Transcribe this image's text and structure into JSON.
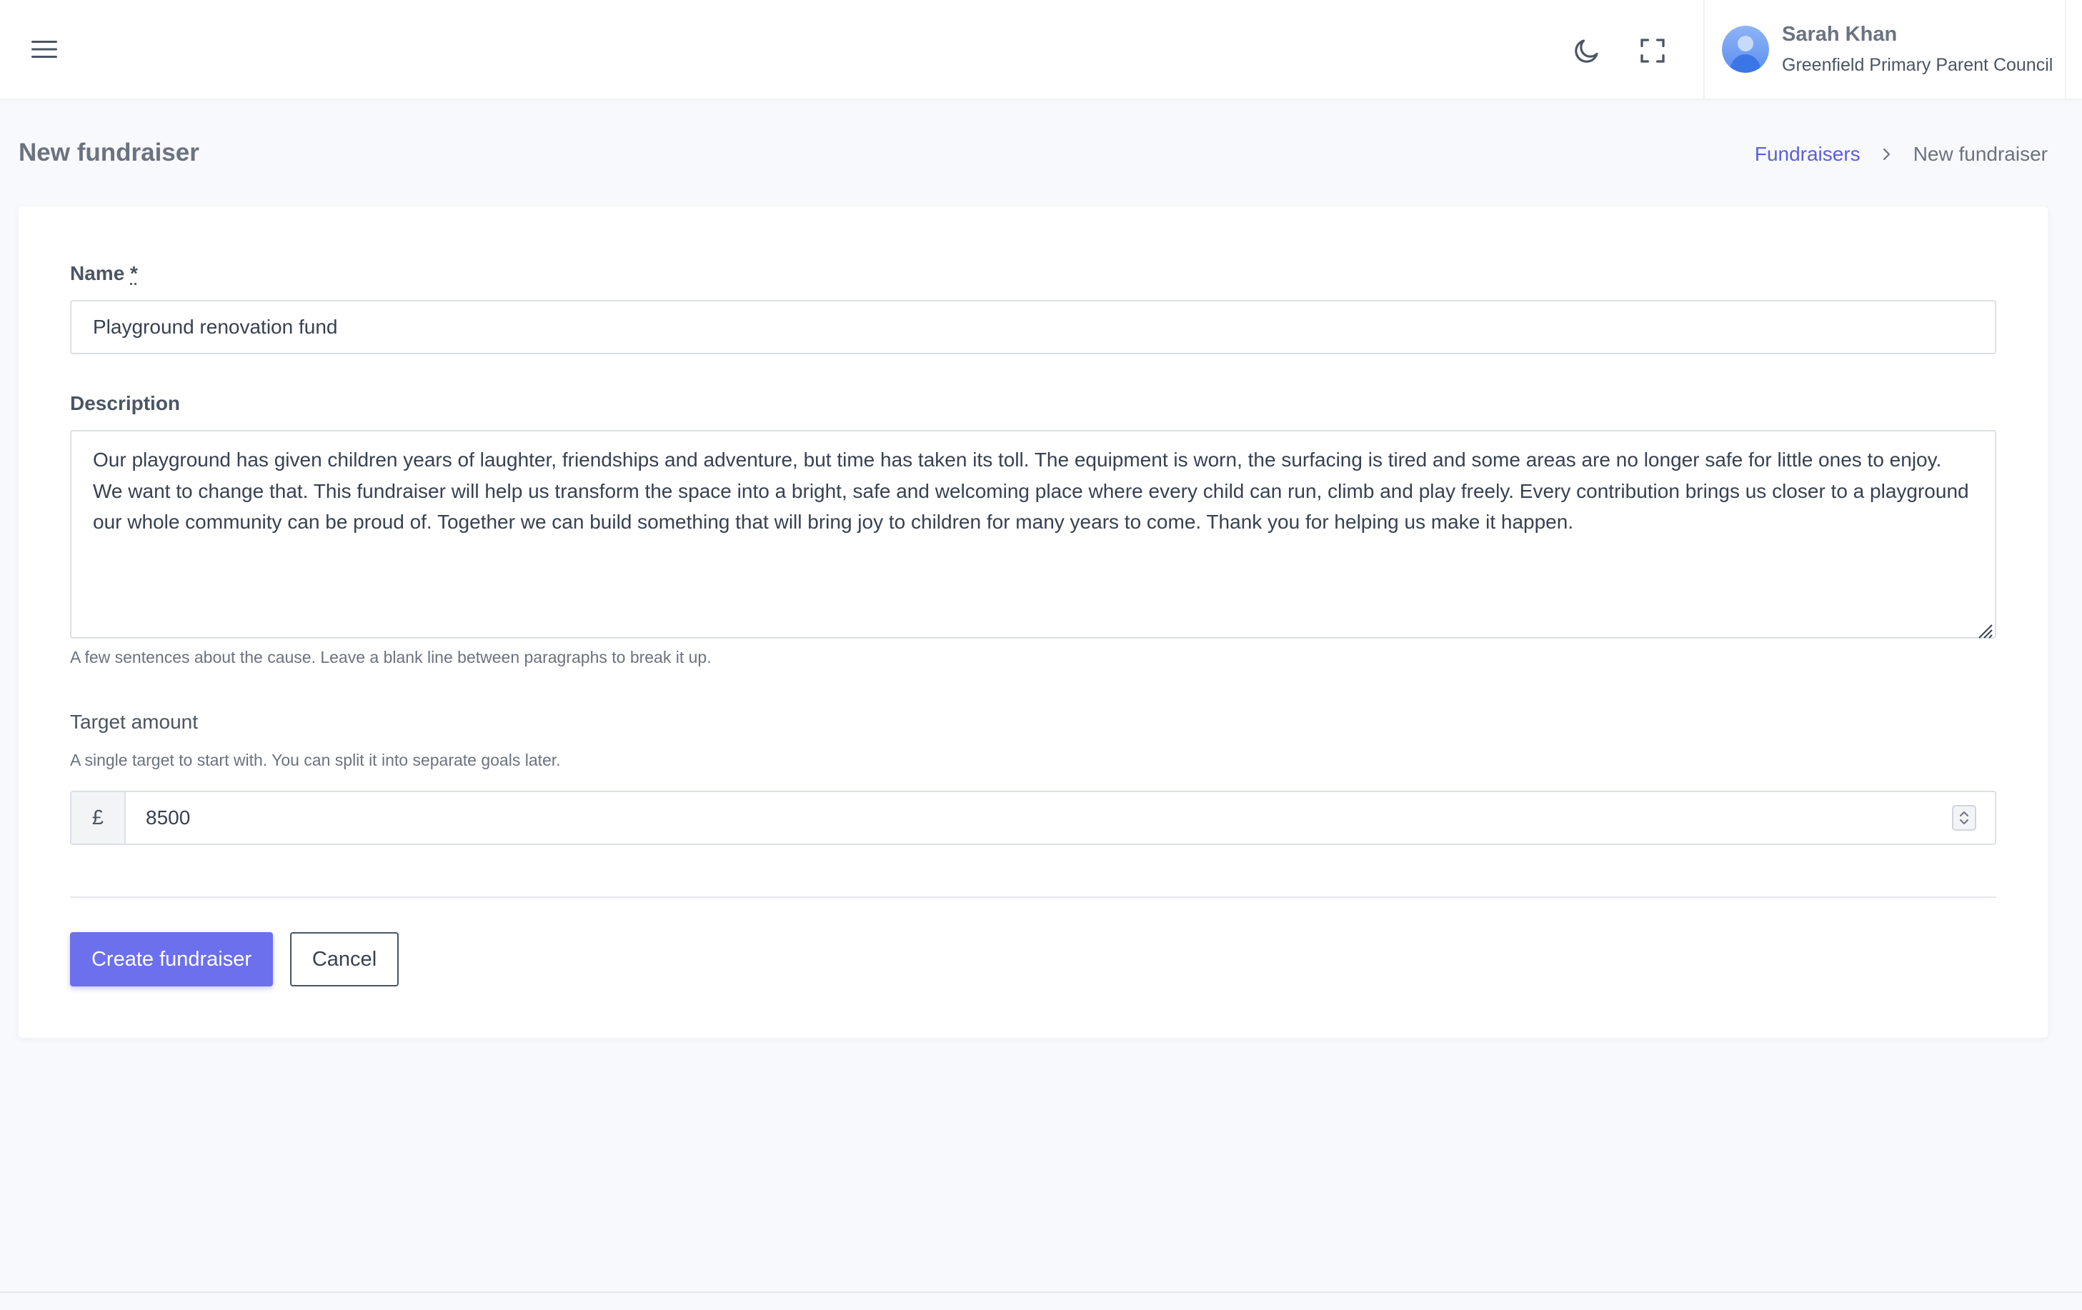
{
  "header": {
    "menu_icon": "hamburger-icon",
    "theme_icon": "moon-icon",
    "fullscreen_icon": "fullscreen-icon",
    "user": {
      "name": "Sarah Khan",
      "organization": "Greenfield Primary Parent Council",
      "avatar_icon": "user-avatar-icon"
    }
  },
  "page": {
    "title": "New fundraiser",
    "breadcrumb": {
      "link": "Fundraisers",
      "separator_icon": "chevron-right-icon",
      "current": "New fundraiser"
    }
  },
  "form": {
    "name": {
      "label": "Name",
      "required_mark": "*",
      "value": "Playground renovation fund"
    },
    "description": {
      "label": "Description",
      "value": "Our playground has given children years of laughter, friendships and adventure, but time has taken its toll. The equipment is worn, the surfacing is tired and some areas are no longer safe for little ones to enjoy. We want to change that. This fundraiser will help us transform the space into a bright, safe and welcoming place where every child can run, climb and play freely. Every contribution brings us closer to a playground our whole community can be proud of. Together we can build something that will bring joy to children for many years to come. Thank you for helping us make it happen.",
      "help": "A few sentences about the cause. Leave a blank line between paragraphs to break it up."
    },
    "target": {
      "label": "Target amount",
      "help": "A single target to start with. You can split it into separate goals later.",
      "currency_symbol": "£",
      "value": "8500"
    },
    "actions": {
      "submit_label": "Create fundraiser",
      "cancel_label": "Cancel"
    }
  },
  "colors": {
    "accent": "#6d70ec",
    "link": "#5a5ee0",
    "background": "#f8f9fc"
  }
}
